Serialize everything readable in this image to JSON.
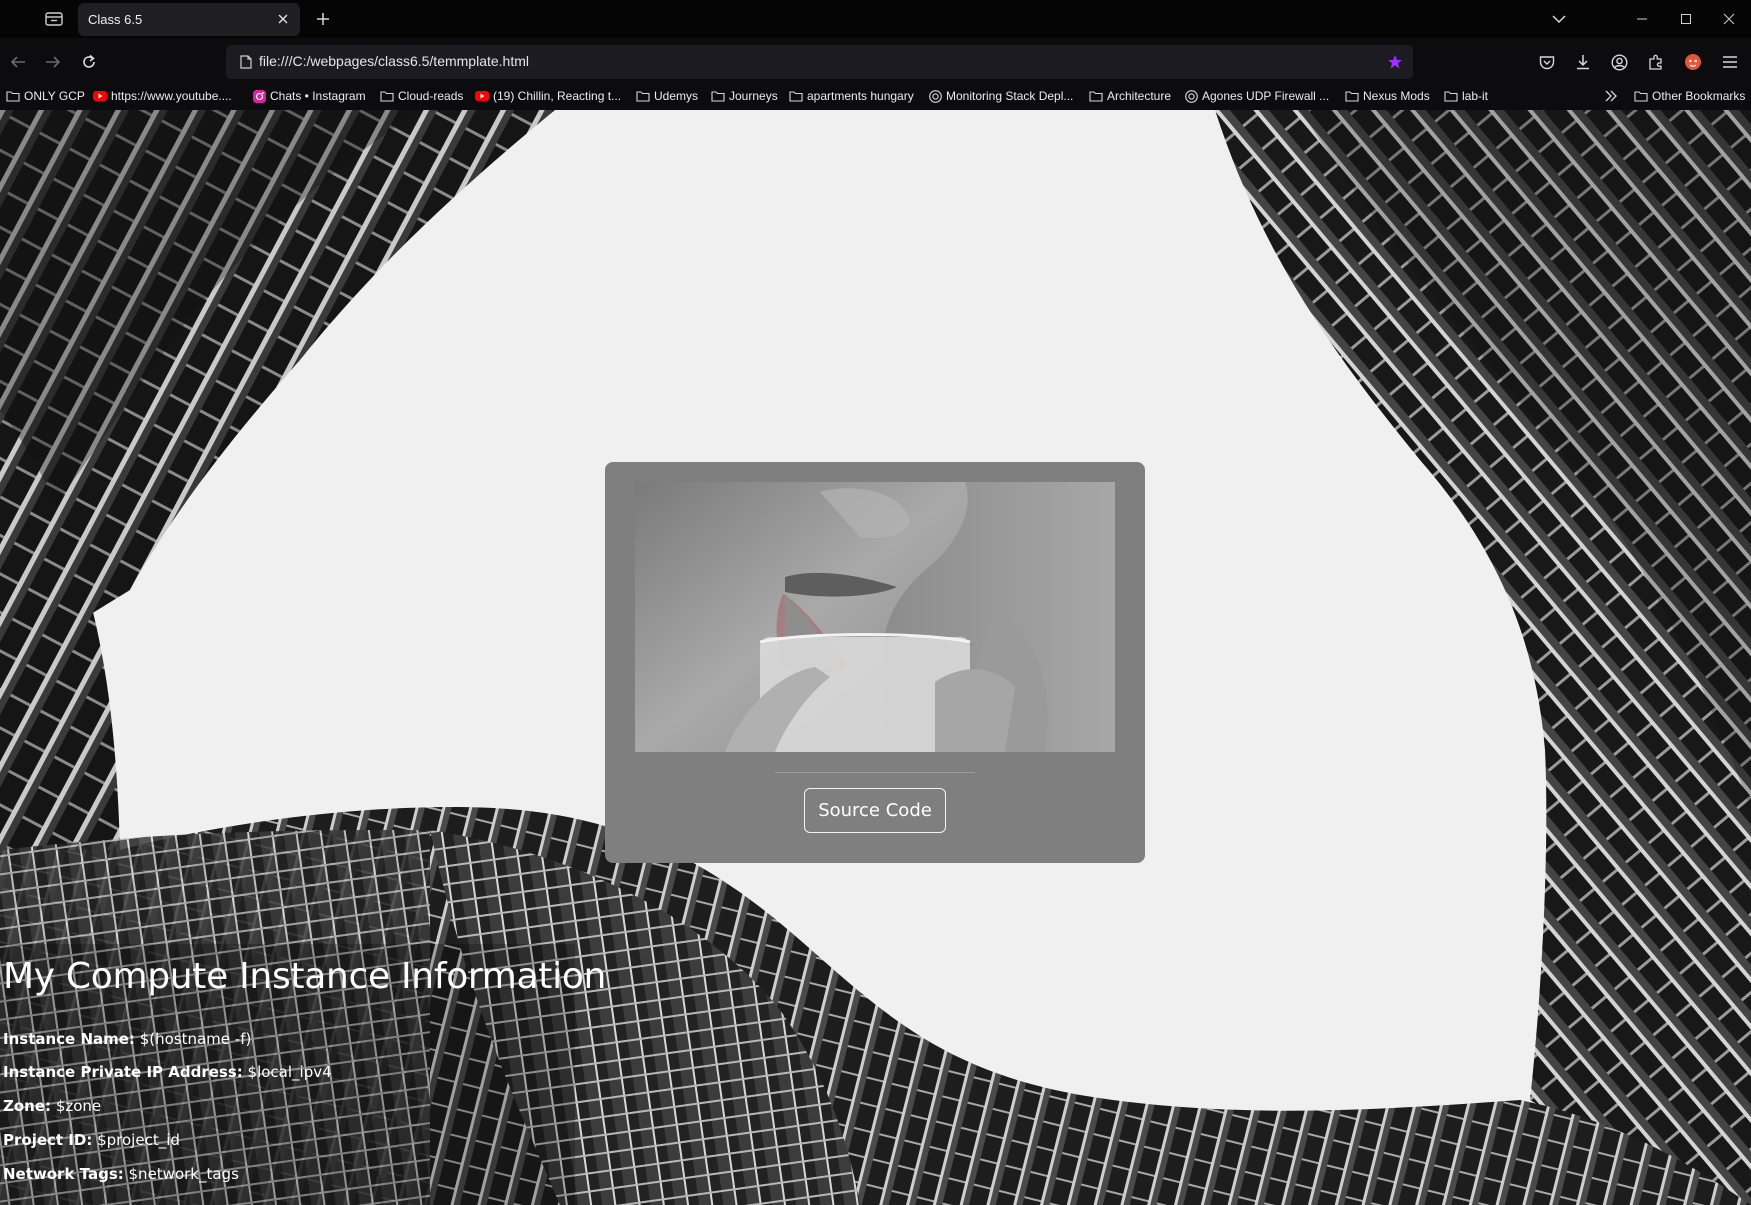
{
  "browser": {
    "tab": {
      "title": "Class 6.5"
    },
    "url": "file:///C:/webpages/class6.5/temmplate.html",
    "bookmarks": [
      {
        "label": "ONLY GCP",
        "icon": "folder-icon"
      },
      {
        "label": "https://www.youtube....",
        "icon": "youtube-icon"
      },
      {
        "label": "Chats • Instagram",
        "icon": "instagram-icon"
      },
      {
        "label": "Cloud-reads",
        "icon": "folder-icon"
      },
      {
        "label": "(19) Chillin, Reacting t...",
        "icon": "youtube-icon"
      },
      {
        "label": "Udemys",
        "icon": "folder-icon"
      },
      {
        "label": "Journeys",
        "icon": "folder-icon"
      },
      {
        "label": "apartments hungary",
        "icon": "folder-icon"
      },
      {
        "label": "Monitoring Stack Depl...",
        "icon": "globe-icon"
      },
      {
        "label": "Architecture",
        "icon": "folder-icon"
      },
      {
        "label": "Agones UDP Firewall ...",
        "icon": "globe-icon"
      },
      {
        "label": "Nexus Mods",
        "icon": "folder-icon"
      },
      {
        "label": "lab-it",
        "icon": "folder-icon"
      }
    ],
    "other_bookmarks": "Other Bookmarks",
    "colors": {
      "star": "#9b30ff",
      "extension": "#e5543a"
    }
  },
  "card": {
    "button_label": "Source Code"
  },
  "info": {
    "title": "My Compute Instance Information",
    "rows": [
      {
        "label": "Instance Name:",
        "value": " $(hostname -f)"
      },
      {
        "label": "Instance Private IP Address:",
        "value": " $local_ipv4"
      },
      {
        "label": "Zone:",
        "value": " $zone"
      },
      {
        "label": "Project ID:",
        "value": " $project_id"
      },
      {
        "label": "Network Tags:",
        "value": " $network_tags"
      }
    ]
  }
}
